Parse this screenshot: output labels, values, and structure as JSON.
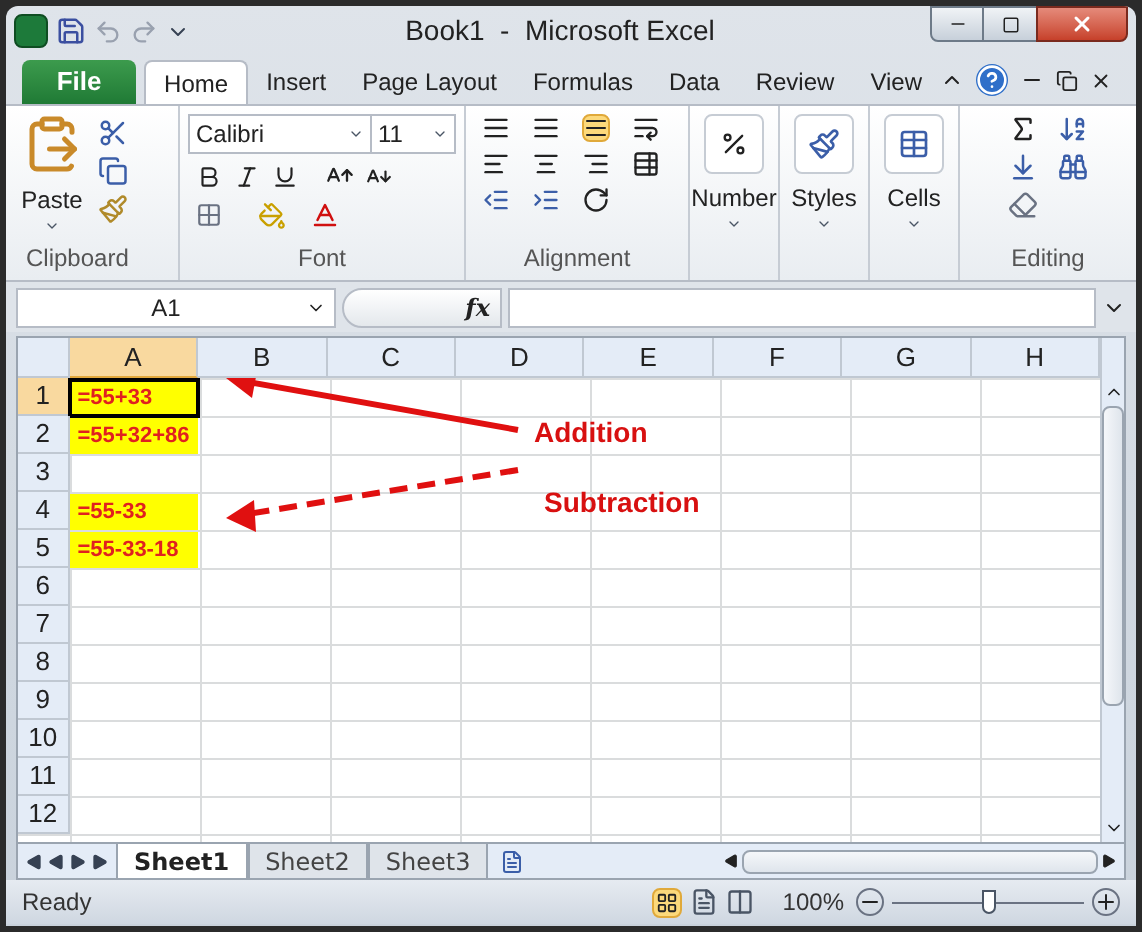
{
  "window": {
    "title": "Book1  -  Microsoft Excel"
  },
  "ribbon_tabs": [
    {
      "label": "File",
      "kind": "file",
      "selected": false
    },
    {
      "label": "Home",
      "kind": "tab",
      "selected": true
    },
    {
      "label": "Insert",
      "kind": "tab",
      "selected": false
    },
    {
      "label": "Page Layout",
      "kind": "tab",
      "selected": false
    },
    {
      "label": "Formulas",
      "kind": "tab",
      "selected": false
    },
    {
      "label": "Data",
      "kind": "tab",
      "selected": false
    },
    {
      "label": "Review",
      "kind": "tab",
      "selected": false
    },
    {
      "label": "View",
      "kind": "tab",
      "selected": false
    }
  ],
  "clipboard": {
    "label": "Clipboard",
    "paste": "Paste"
  },
  "font": {
    "label": "Font",
    "name": "Calibri",
    "size": "11"
  },
  "alignment": {
    "label": "Alignment"
  },
  "big_buttons": [
    {
      "label": "Number",
      "kind": "number"
    },
    {
      "label": "Styles",
      "kind": "styles"
    },
    {
      "label": "Cells",
      "kind": "cells"
    }
  ],
  "editing": {
    "label": "Editing"
  },
  "name_box": "A1",
  "formula_bar": {
    "function_label": "fx"
  },
  "columns": [
    {
      "label": "A",
      "selected": true
    },
    {
      "label": "B",
      "selected": false
    },
    {
      "label": "C",
      "selected": false
    },
    {
      "label": "D",
      "selected": false
    },
    {
      "label": "E",
      "selected": false
    },
    {
      "label": "F",
      "selected": false
    },
    {
      "label": "G",
      "selected": false
    },
    {
      "label": "H",
      "selected": false
    }
  ],
  "rows": [
    {
      "label": "1",
      "selected": true,
      "cell_a": "=55+33",
      "highlighted": true
    },
    {
      "label": "2",
      "selected": false,
      "cell_a": "=55+32+86",
      "highlighted": true
    },
    {
      "label": "3",
      "selected": false,
      "highlighted": false
    },
    {
      "label": "4",
      "selected": false,
      "cell_a": "=55-33",
      "highlighted": true
    },
    {
      "label": "5",
      "selected": false,
      "cell_a": "=55-33-18",
      "highlighted": true
    },
    {
      "label": "6",
      "selected": false,
      "highlighted": false
    },
    {
      "label": "7",
      "selected": false,
      "highlighted": false
    },
    {
      "label": "8",
      "selected": false,
      "highlighted": false
    },
    {
      "label": "9",
      "selected": false,
      "highlighted": false
    },
    {
      "label": "10",
      "selected": false,
      "highlighted": false
    },
    {
      "label": "11",
      "selected": false,
      "highlighted": false
    },
    {
      "label": "12",
      "selected": false,
      "highlighted": false
    }
  ],
  "annotations": [
    {
      "label": "Addition",
      "kind": "solid"
    },
    {
      "label": "Subtraction",
      "kind": "dashed"
    }
  ],
  "sheet_tabs": [
    {
      "label": "Sheet1",
      "selected": true
    },
    {
      "label": "Sheet2",
      "selected": false
    },
    {
      "label": "Sheet3",
      "selected": false
    }
  ],
  "status_bar": {
    "status": "Ready",
    "zoom": "100%",
    "zoom_slider": {
      "level": 0.5
    }
  }
}
